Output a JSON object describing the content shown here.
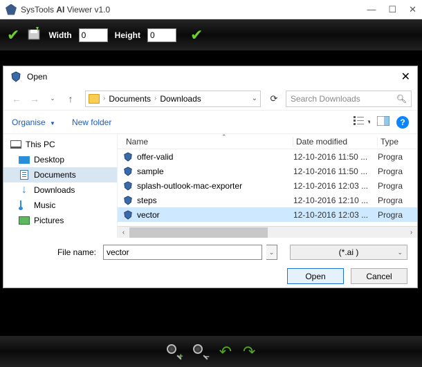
{
  "app": {
    "brand": "SysTools",
    "name": "AI",
    "suffix": "Viewer v1.0"
  },
  "toolbar": {
    "width_label": "Width",
    "width_value": "0",
    "height_label": "Height",
    "height_value": "0"
  },
  "dialog": {
    "title": "Open",
    "breadcrumb": {
      "seg1": "Documents",
      "seg2": "Downloads"
    },
    "search_placeholder": "Search Downloads",
    "organise": "Organise",
    "newfolder": "New folder",
    "tree": {
      "thispc": "This PC",
      "desktop": "Desktop",
      "documents": "Documents",
      "downloads": "Downloads",
      "music": "Music",
      "pictures": "Pictures"
    },
    "columns": {
      "name": "Name",
      "date": "Date modified",
      "type": "Type"
    },
    "files": [
      {
        "name": "offer-valid",
        "date": "12-10-2016 11:50 ...",
        "type": "Progra"
      },
      {
        "name": "sample",
        "date": "12-10-2016 11:50 ...",
        "type": "Progra"
      },
      {
        "name": "splash-outlook-mac-exporter",
        "date": "12-10-2016 12:03 ...",
        "type": "Progra"
      },
      {
        "name": "steps",
        "date": "12-10-2016 12:10 ...",
        "type": "Progra"
      },
      {
        "name": "vector",
        "date": "12-10-2016 12:03 ...",
        "type": "Progra"
      }
    ],
    "filename_label": "File name:",
    "filename_value": "vector",
    "filetype": "(*.ai )",
    "open_btn": "Open",
    "cancel_btn": "Cancel",
    "help": "?"
  }
}
